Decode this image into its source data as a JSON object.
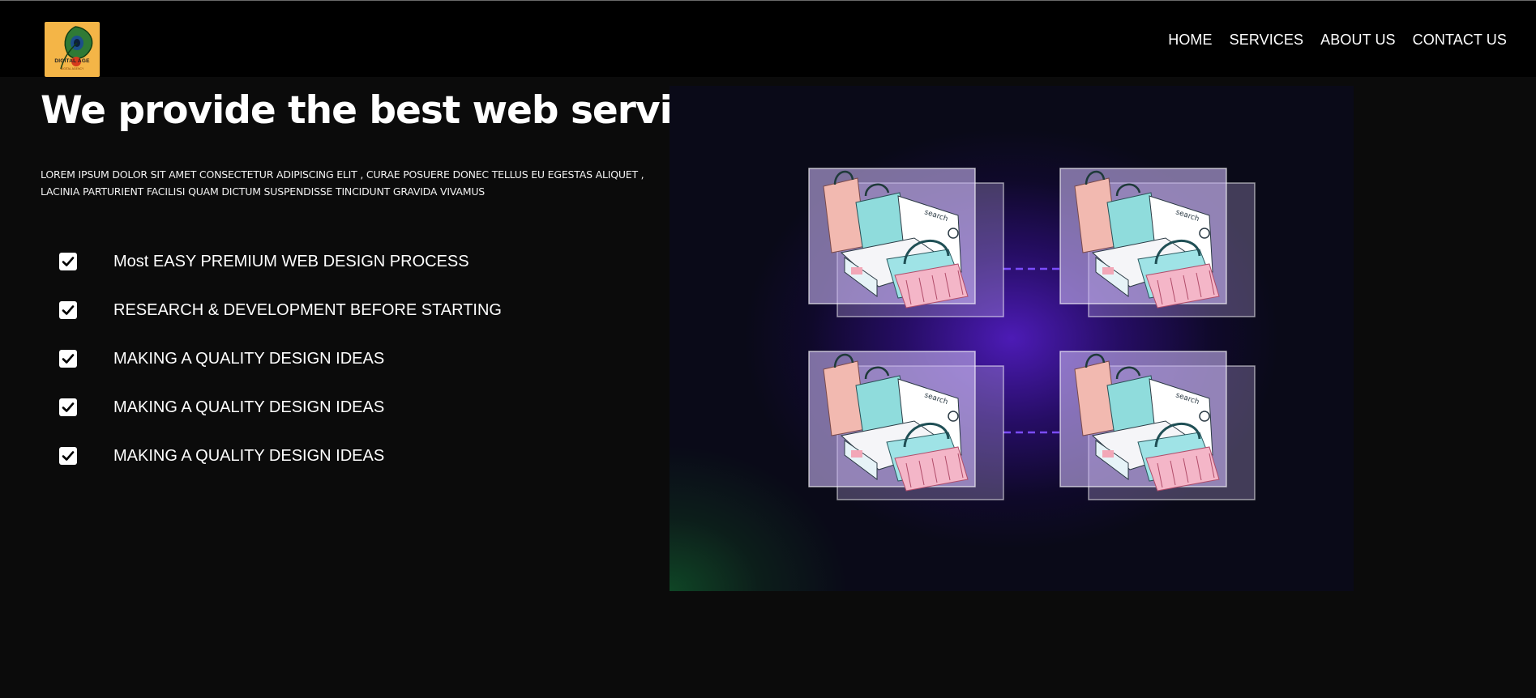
{
  "header": {
    "logo": {
      "text": "DIGITAL AGE",
      "subtext": "DIGITAL AGENCY",
      "icon": "peacock-feather-icon",
      "bg_color": "#f4b547"
    },
    "nav": [
      {
        "label": "HOME"
      },
      {
        "label": "SERVICES"
      },
      {
        "label": "ABOUT US"
      },
      {
        "label": "CONTACT US"
      }
    ]
  },
  "hero": {
    "title": "We provide the best web services",
    "description": "LOREM IPSUM DOLOR SIT AMET CONSECTETUR ADIPISCING ELIT , CURAE POSUERE DONEC TELLUS EU EGESTAS ALIQUET , LACINIA PARTURIENT FACILISI QUAM DICTUM SUSPENDISSE TINCIDUNT GRAVIDA VIVAMUS",
    "features": [
      {
        "label": "Most EASY PREMIUM WEB DESIGN PROCESS",
        "icon": "checkbox-checked-icon"
      },
      {
        "label": "RESEARCH & DEVELOPMENT BEFORE STARTING",
        "icon": "checkbox-checked-icon"
      },
      {
        "label": "MAKING A QUALITY DESIGN IDEAS",
        "icon": "checkbox-checked-icon"
      },
      {
        "label": "MAKING A QUALITY DESIGN IDEAS",
        "icon": "checkbox-checked-icon"
      },
      {
        "label": "MAKING A QUALITY DESIGN IDEAS",
        "icon": "checkbox-checked-icon"
      }
    ],
    "image": {
      "card_label": "search",
      "cards": 4,
      "accent_color": "#5b2dd6"
    }
  }
}
